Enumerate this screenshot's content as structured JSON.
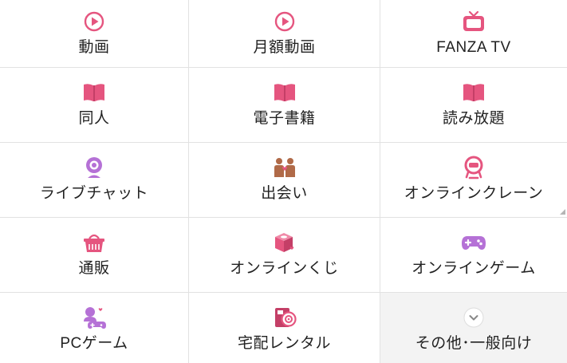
{
  "menu": {
    "items": [
      {
        "label": "動画",
        "icon": "play-circle-icon"
      },
      {
        "label": "月額動画",
        "icon": "play-circle-icon"
      },
      {
        "label": "FANZA TV",
        "icon": "tv-icon"
      },
      {
        "label": "同人",
        "icon": "open-book-icon"
      },
      {
        "label": "電子書籍",
        "icon": "open-book-icon"
      },
      {
        "label": "読み放題",
        "icon": "open-book-icon"
      },
      {
        "label": "ライブチャット",
        "icon": "webcam-icon"
      },
      {
        "label": "出会い",
        "icon": "couple-icon"
      },
      {
        "label": "オンラインクレーン",
        "icon": "crane-game-icon"
      },
      {
        "label": "通販",
        "icon": "shopping-basket-icon"
      },
      {
        "label": "オンラインくじ",
        "icon": "lottery-box-icon"
      },
      {
        "label": "オンラインゲーム",
        "icon": "gamepad-icon"
      },
      {
        "label": "PCゲーム",
        "icon": "pc-game-icon"
      },
      {
        "label": "宅配レンタル",
        "icon": "rental-disc-icon"
      },
      {
        "label": "その他･一般向け",
        "icon": "chevron-down-icon"
      }
    ]
  },
  "colors": {
    "pink": "#e5557f",
    "purple": "#b571d6",
    "brown": "#b06a48",
    "gray": "#888888",
    "divider": "#e2e2e2",
    "more_bg": "#f3f3f3"
  }
}
